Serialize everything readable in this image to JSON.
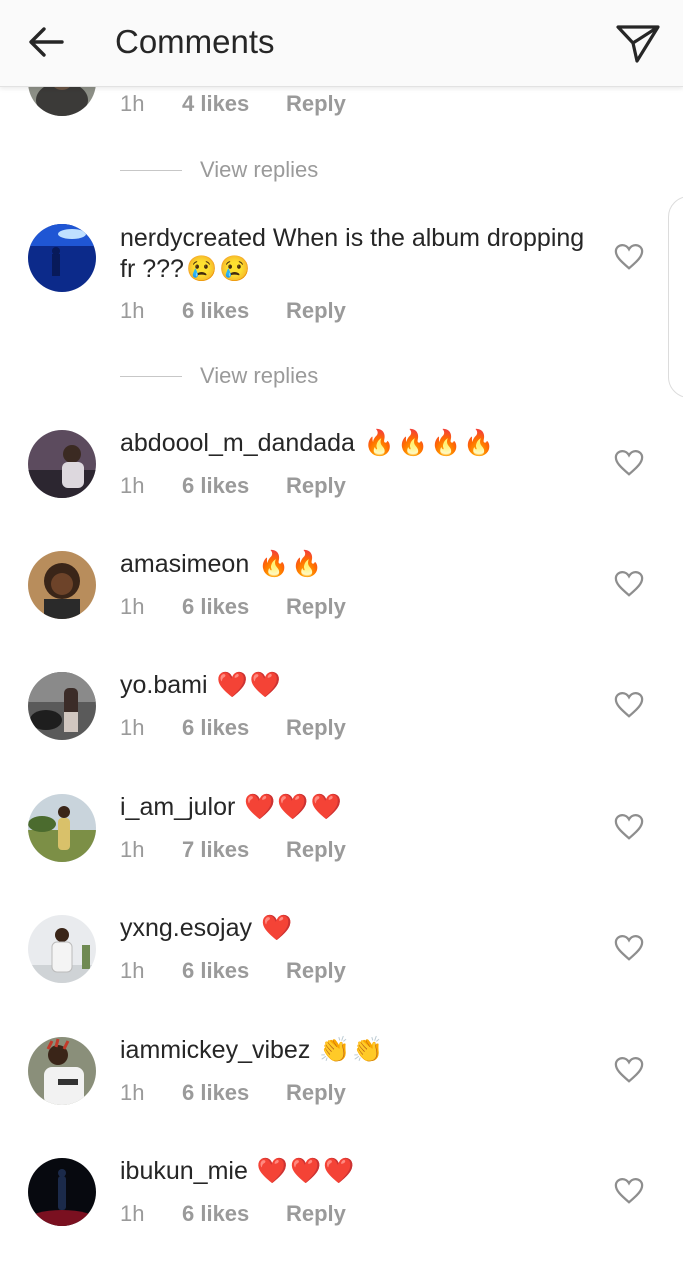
{
  "header": {
    "title": "Comments",
    "back_icon": "arrow-left-icon",
    "send_icon": "paper-plane-icon"
  },
  "top_partial": {
    "time": "1h",
    "likes": "4 likes",
    "reply": "Reply"
  },
  "view_replies_label": "View replies",
  "comments": [
    {
      "username": "nerdycreated",
      "text": "When is the album dropping fr ???",
      "emoji": "😢😢",
      "time": "1h",
      "likes": "6 likes",
      "reply": "Reply"
    },
    {
      "username": "abdoool_m_dandada",
      "text": "",
      "emoji": "🔥🔥🔥🔥",
      "time": "1h",
      "likes": "6 likes",
      "reply": "Reply"
    },
    {
      "username": "amasimeon",
      "text": "",
      "emoji": "🔥🔥",
      "time": "1h",
      "likes": "6 likes",
      "reply": "Reply"
    },
    {
      "username": "yo.bami",
      "text": "",
      "emoji": "❤️❤️",
      "time": "1h",
      "likes": "6 likes",
      "reply": "Reply"
    },
    {
      "username": "i_am_julor",
      "text": "",
      "emoji": "❤️❤️❤️",
      "time": "1h",
      "likes": "7 likes",
      "reply": "Reply"
    },
    {
      "username": "yxng.esojay",
      "text": "",
      "emoji": "❤️",
      "time": "1h",
      "likes": "6 likes",
      "reply": "Reply"
    },
    {
      "username": "iammickey_vibez",
      "text": "",
      "emoji": "👏👏",
      "time": "1h",
      "likes": "6 likes",
      "reply": "Reply"
    },
    {
      "username": "ibukun_mie",
      "text": "",
      "emoji": "❤️❤️❤️",
      "time": "1h",
      "likes": "6 likes",
      "reply": "Reply"
    }
  ],
  "colors": {
    "text": "#262626",
    "meta": "#9a9a9a",
    "header_bg": "#fafafa"
  }
}
